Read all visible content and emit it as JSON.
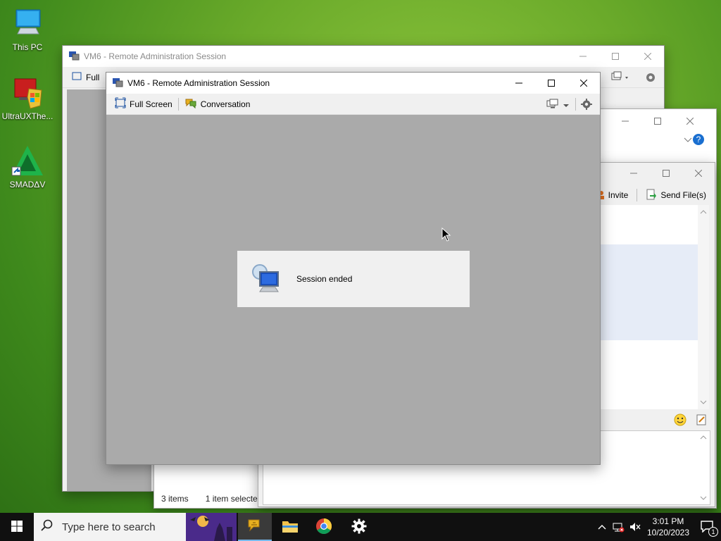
{
  "desktop": {
    "icons": [
      {
        "label": "This PC"
      },
      {
        "label": "UltraUXThe..."
      },
      {
        "label": "SMADΔV"
      }
    ]
  },
  "back_window": {
    "title": "VM6 - Remote Administration Session",
    "toolbar_partial": "Full"
  },
  "explorer_window": {
    "status_items": "3 items",
    "status_selected": "1 item selecte"
  },
  "chat_window": {
    "invite_label": "Invite",
    "send_files_label": "Send File(s)"
  },
  "main_window": {
    "title": "VM6 - Remote Administration Session",
    "toolbar": {
      "full_screen": "Full Screen",
      "conversation": "Conversation"
    },
    "session_message": "Session ended"
  },
  "taskbar": {
    "search_placeholder": "Type here to search",
    "time": "3:01 PM",
    "date": "10/20/2023",
    "notification_count": "1"
  },
  "colors": {
    "session_bg": "#aaaaaa",
    "titlebar_active": "#ffffff",
    "taskbar_bg": "#101010"
  }
}
